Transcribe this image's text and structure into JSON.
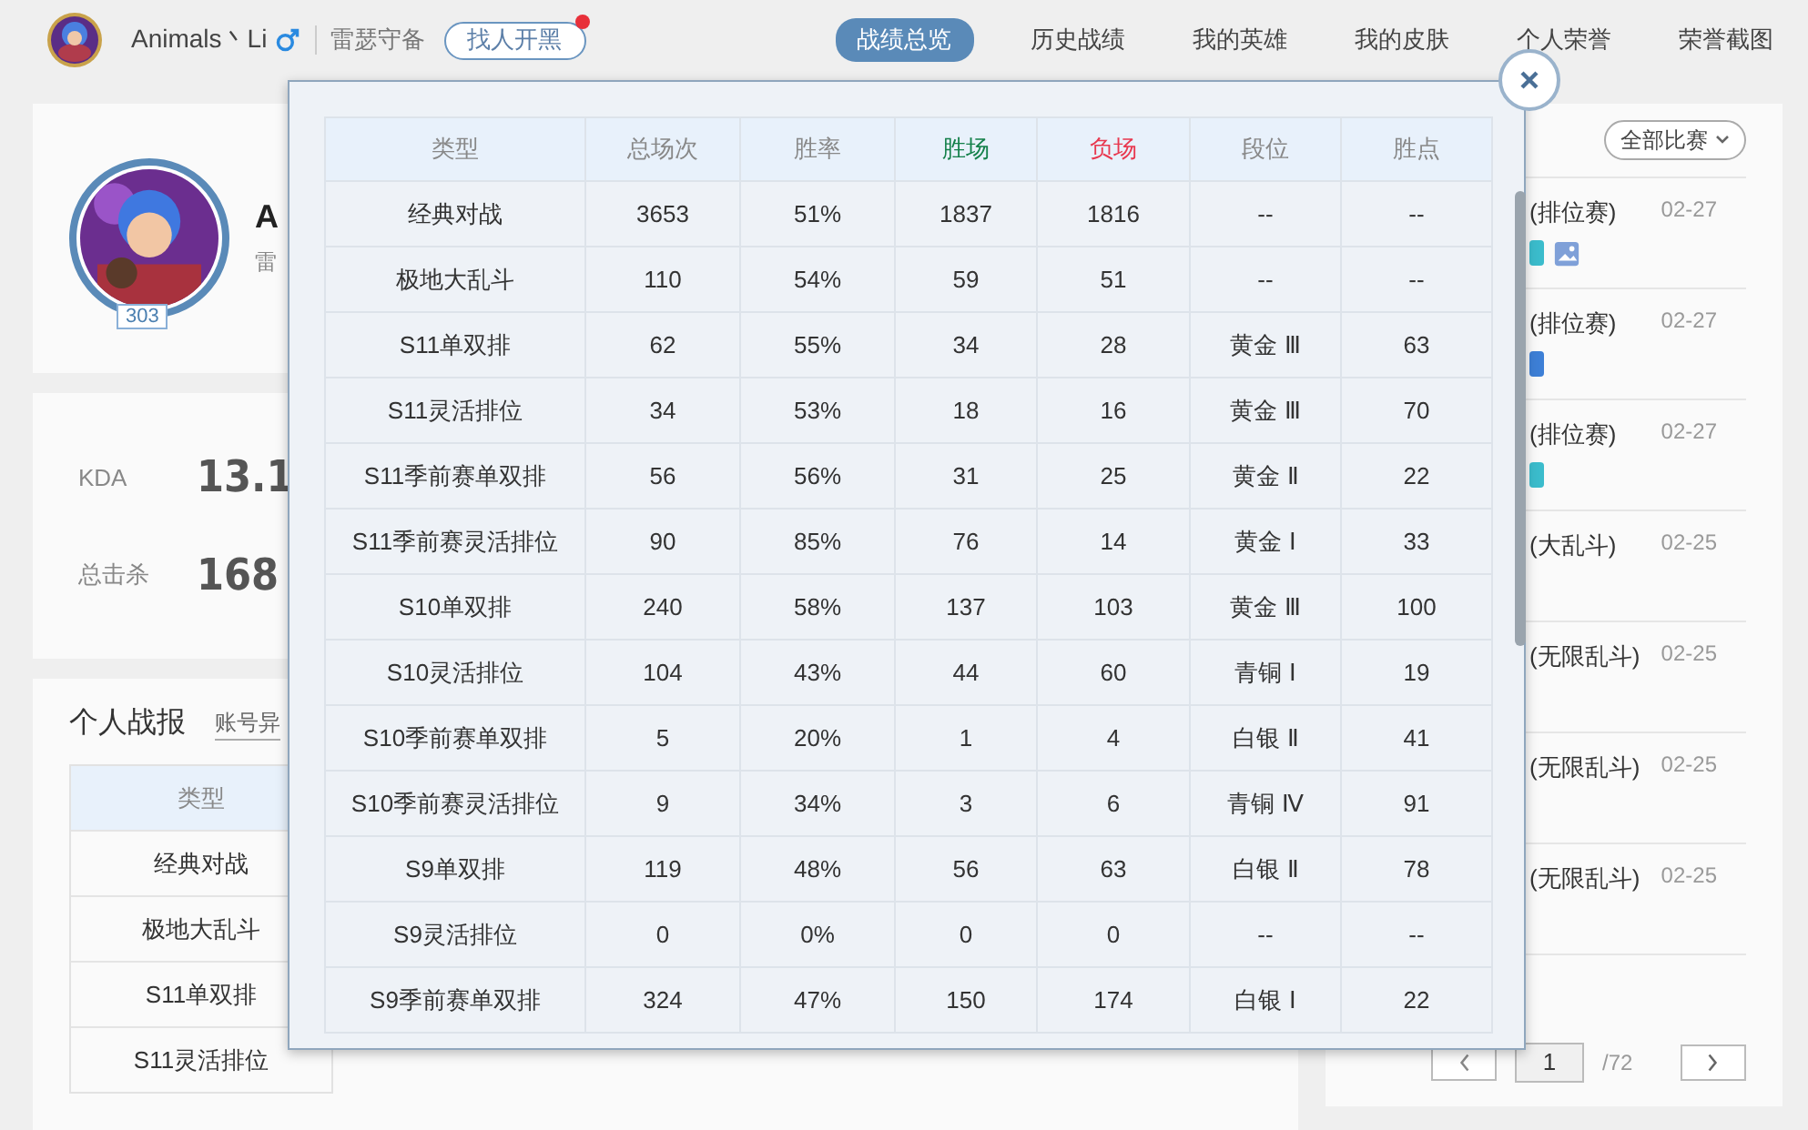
{
  "header": {
    "nickname": "Animals丶Li",
    "server": "雷瑟守备",
    "find_button": {
      "label": "找人开黑",
      "notification": true
    }
  },
  "nav_tabs": [
    {
      "label": "战绩总览",
      "selected": true
    },
    {
      "label": "历史战绩",
      "selected": false
    },
    {
      "label": "我的英雄",
      "selected": false
    },
    {
      "label": "我的皮肤",
      "selected": false
    },
    {
      "label": "个人荣誉",
      "selected": false
    },
    {
      "label": "荣誉截图",
      "selected": false
    }
  ],
  "profile": {
    "name": "A",
    "server": "雷",
    "level": "303"
  },
  "stats": [
    {
      "label": "KDA",
      "value": "13.1"
    },
    {
      "label": "总击杀",
      "value": "168"
    }
  ],
  "report": {
    "title": "个人战报",
    "link": "账号异",
    "column": "类型",
    "rows": [
      "经典对战",
      "极地大乱斗",
      "S11单双排",
      "S11灵活排位"
    ]
  },
  "matches": {
    "filter": "全部比赛",
    "items": [
      {
        "title": "(排位赛)",
        "date": "02-27",
        "color": "#3bbccc",
        "screenshot": true
      },
      {
        "title": "(排位赛)",
        "date": "02-27",
        "color": "#3d7fd6",
        "screenshot": false
      },
      {
        "title": "(排位赛)",
        "date": "02-27",
        "color": "#3bbccc",
        "screenshot": false
      },
      {
        "title": "(大乱斗)",
        "date": "02-25",
        "screenshot": false
      },
      {
        "title": "(无限乱斗)",
        "date": "02-25",
        "screenshot": false
      },
      {
        "title": "(无限乱斗)",
        "date": "02-25",
        "screenshot": false
      },
      {
        "title": "(无限乱斗)",
        "date": "02-25",
        "screenshot": false
      }
    ]
  },
  "pagination": {
    "page": "1",
    "total": "/72"
  },
  "modal": {
    "columns": [
      {
        "label": "类型"
      },
      {
        "label": "总场次"
      },
      {
        "label": "胜率"
      },
      {
        "label": "胜场",
        "color": "#14804a"
      },
      {
        "label": "负场",
        "color": "#e8384f"
      },
      {
        "label": "段位"
      },
      {
        "label": "胜点"
      }
    ],
    "rows": [
      [
        "经典对战",
        "3653",
        "51%",
        "1837",
        "1816",
        "--",
        "--"
      ],
      [
        "极地大乱斗",
        "110",
        "54%",
        "59",
        "51",
        "--",
        "--"
      ],
      [
        "S11单双排",
        "62",
        "55%",
        "34",
        "28",
        "黄金 Ⅲ",
        "63"
      ],
      [
        "S11灵活排位",
        "34",
        "53%",
        "18",
        "16",
        "黄金 Ⅲ",
        "70"
      ],
      [
        "S11季前赛单双排",
        "56",
        "56%",
        "31",
        "25",
        "黄金 Ⅱ",
        "22"
      ],
      [
        "S11季前赛灵活排位",
        "90",
        "85%",
        "76",
        "14",
        "黄金 Ⅰ",
        "33"
      ],
      [
        "S10单双排",
        "240",
        "58%",
        "137",
        "103",
        "黄金 Ⅲ",
        "100"
      ],
      [
        "S10灵活排位",
        "104",
        "43%",
        "44",
        "60",
        "青铜 Ⅰ",
        "19"
      ],
      [
        "S10季前赛单双排",
        "5",
        "20%",
        "1",
        "4",
        "白银 Ⅱ",
        "41"
      ],
      [
        "S10季前赛灵活排位",
        "9",
        "34%",
        "3",
        "6",
        "青铜 Ⅳ",
        "91"
      ],
      [
        "S9单双排",
        "119",
        "48%",
        "56",
        "63",
        "白银 Ⅱ",
        "78"
      ],
      [
        "S9灵活排位",
        "0",
        "0%",
        "0",
        "0",
        "--",
        "--"
      ],
      [
        "S9季前赛单双排",
        "324",
        "47%",
        "150",
        "174",
        "白银 Ⅰ",
        "22"
      ]
    ]
  }
}
